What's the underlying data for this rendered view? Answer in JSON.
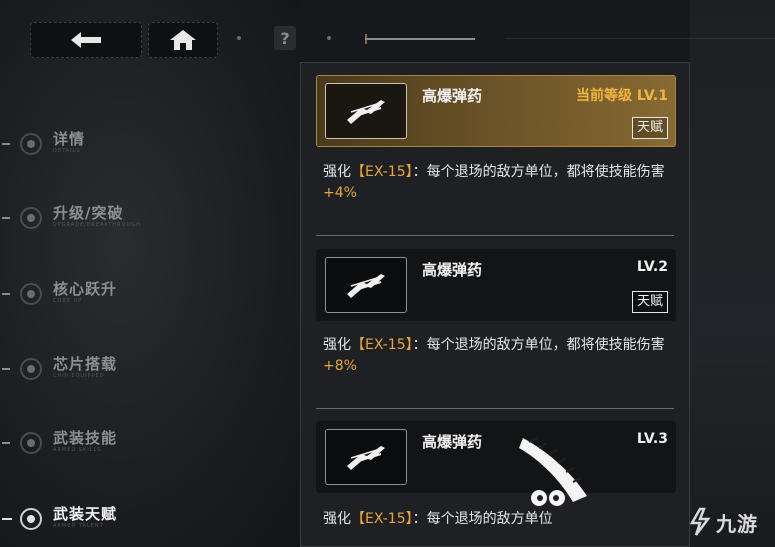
{
  "topbar": {
    "back_icon": "back-arrow-icon",
    "home_icon": "home-icon",
    "help_label": "?"
  },
  "sidebar": {
    "items": [
      {
        "label": "详情",
        "sub": "DETAILS",
        "icon": "details-icon",
        "active": false
      },
      {
        "label": "升级/突破",
        "sub": "UPGRADE/BREAKTHROUGH",
        "icon": "upgrade-icon",
        "active": false
      },
      {
        "label": "核心跃升",
        "sub": "CORE UP",
        "icon": "core-icon",
        "active": false
      },
      {
        "label": "芯片搭载",
        "sub": "CHIP EQUIPPED",
        "icon": "chip-icon",
        "active": false
      },
      {
        "label": "武装技能",
        "sub": "ARMED SKILLS",
        "icon": "skill-icon",
        "active": false
      },
      {
        "label": "武装天赋",
        "sub": "ARMED TALENT",
        "icon": "talent-icon",
        "active": true
      }
    ]
  },
  "panel": {
    "cards": [
      {
        "name": "高爆弹药",
        "level": "当前等级 LV.1",
        "badge": "天赋",
        "current": true,
        "desc_prefix": "强化",
        "desc_tag": "【EX-15】",
        "desc_body": "：每个退场的敌方单位，都将使技能伤害",
        "desc_bonus": "+4%"
      },
      {
        "name": "高爆弹药",
        "level": "LV.2",
        "badge": "天赋",
        "current": false,
        "desc_prefix": "强化",
        "desc_tag": "【EX-15】",
        "desc_body": "：每个退场的敌方单位，都将使技能伤害",
        "desc_bonus": "+8%"
      },
      {
        "name": "高爆弹药",
        "level": "LV.3",
        "badge": "",
        "current": false,
        "desc_prefix": "强化",
        "desc_tag": "【EX-15】",
        "desc_body": "：每个退场的敌方单位",
        "desc_bonus": ""
      }
    ]
  },
  "watermark": {
    "text": "九游",
    "icon": "jiuyou-logo-icon"
  },
  "colors": {
    "accent_gold": "#f2b640",
    "highlight_orange": "#e8a63a",
    "panel_bg": "#1e2024"
  }
}
